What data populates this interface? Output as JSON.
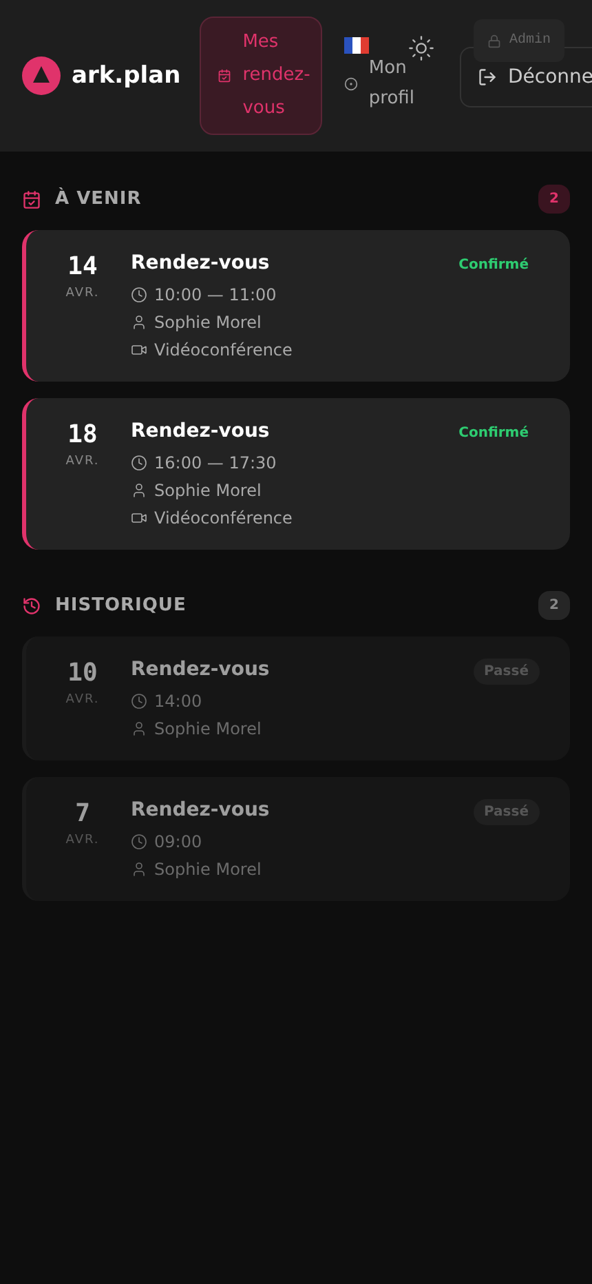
{
  "header": {
    "logo": "ark.plan",
    "nav": [
      {
        "label": "Mes rendez-vous",
        "selected": true
      }
    ],
    "profile": {
      "label": "Mon profil"
    },
    "admin_badge": "Admin",
    "logout": "Déconne"
  },
  "sections": [
    {
      "kind": "upcoming",
      "title": "À VENIR",
      "count": "2",
      "appointments": [
        {
          "day": "14",
          "month": "AVR.",
          "title": "Rendez-vous",
          "time": "10:00 — 11:00",
          "person": "Sophie Morel",
          "location": "Vidéoconférence",
          "status": "Confirmé",
          "kind": "confirmed"
        },
        {
          "day": "18",
          "month": "AVR.",
          "title": "Rendez-vous",
          "time": "16:00 — 17:30",
          "person": "Sophie Morel",
          "location": "Vidéoconférence",
          "status": "Confirmé",
          "kind": "confirmed"
        }
      ]
    },
    {
      "kind": "history",
      "title": "HISTORIQUE",
      "count": "2",
      "appointments": [
        {
          "day": "10",
          "month": "AVR.",
          "title": "Rendez-vous",
          "time": "14:00",
          "person": "Sophie Morel",
          "status": "Passé",
          "kind": "past"
        },
        {
          "day": "7",
          "month": "AVR.",
          "title": "Rendez-vous",
          "time": "09:00",
          "person": "Sophie Morel",
          "status": "Passé",
          "kind": "past"
        }
      ]
    }
  ]
}
